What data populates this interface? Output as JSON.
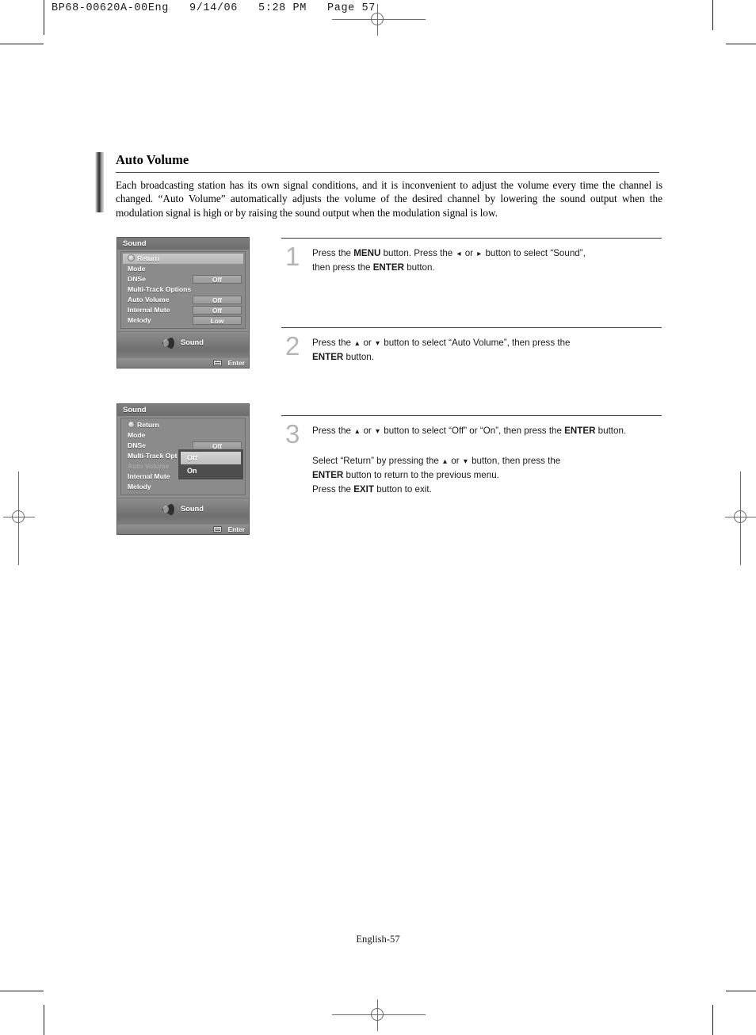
{
  "print_header": "BP68-00620A-00Eng   9/14/06   5:28 PM   Page 57",
  "section": {
    "title": "Auto Volume",
    "body": "Each broadcasting station has its own signal conditions, and it is inconvenient to adjust the volume every time the channel is changed. “Auto Volume” automatically adjusts the volume of the desired channel by lowering the sound output when the modulation signal is high or by raising the sound output when the modulation signal is low."
  },
  "osd_menu_1": {
    "title": "Sound",
    "rows": [
      {
        "label": "Return",
        "value": "",
        "selected": true,
        "icon": "return-icon"
      },
      {
        "label": "Mode",
        "value": ""
      },
      {
        "label": "DNSe",
        "value": "Off"
      },
      {
        "label": "Multi-Track Options",
        "value": ""
      },
      {
        "label": "Auto Volume",
        "value": "Off"
      },
      {
        "label": "Internal Mute",
        "value": "Off"
      },
      {
        "label": "Melody",
        "value": "Low"
      }
    ],
    "footer_label": "Sound",
    "enter_label": "Enter"
  },
  "osd_menu_2": {
    "title": "Sound",
    "rows": [
      {
        "label": "Return",
        "value": "",
        "icon": "return-icon"
      },
      {
        "label": "Mode",
        "value": ""
      },
      {
        "label": "DNSe",
        "value": "Off"
      },
      {
        "label": "Multi-Track Options",
        "value": ""
      },
      {
        "label": "Auto Volume",
        "value": "",
        "dimmed": true
      },
      {
        "label": "Internal Mute",
        "value": ""
      },
      {
        "label": "Melody",
        "value": ""
      }
    ],
    "dropdown": {
      "options": [
        {
          "label": "Off",
          "highlighted": true
        },
        {
          "label": "On",
          "highlighted": false
        }
      ]
    },
    "footer_label": "Sound",
    "enter_label": "Enter"
  },
  "steps": [
    {
      "number": "1",
      "parts": [
        {
          "t": "text",
          "v": "Press the "
        },
        {
          "t": "bold",
          "v": "MENU"
        },
        {
          "t": "text",
          "v": " button. Press the "
        },
        {
          "t": "icon",
          "v": "◂"
        },
        {
          "t": "text",
          "v": " or "
        },
        {
          "t": "icon",
          "v": "▸"
        },
        {
          "t": "text",
          "v": " button to select “Sound”,"
        },
        {
          "t": "br",
          "v": ""
        },
        {
          "t": "text",
          "v": "then press the "
        },
        {
          "t": "bold",
          "v": "ENTER"
        },
        {
          "t": "text",
          "v": " button."
        }
      ]
    },
    {
      "number": "2",
      "parts": [
        {
          "t": "text",
          "v": "Press the "
        },
        {
          "t": "icon",
          "v": "▴"
        },
        {
          "t": "text",
          "v": " or "
        },
        {
          "t": "icon",
          "v": "▾"
        },
        {
          "t": "text",
          "v": " button to select “Auto Volume”, then press the"
        },
        {
          "t": "br",
          "v": ""
        },
        {
          "t": "bold",
          "v": "ENTER"
        },
        {
          "t": "text",
          "v": " button."
        }
      ]
    },
    {
      "number": "3",
      "parts": [
        {
          "t": "text",
          "v": "Press the "
        },
        {
          "t": "icon",
          "v": "▴"
        },
        {
          "t": "text",
          "v": " or "
        },
        {
          "t": "icon",
          "v": "▾"
        },
        {
          "t": "text",
          "v": " button to select “Off” or “On”, then press the "
        },
        {
          "t": "bold",
          "v": "ENTER"
        },
        {
          "t": "text",
          "v": " button."
        }
      ],
      "extra_parts": [
        {
          "t": "text",
          "v": "Select “Return” by pressing the "
        },
        {
          "t": "icon",
          "v": "▴"
        },
        {
          "t": "text",
          "v": " or "
        },
        {
          "t": "icon",
          "v": "▾"
        },
        {
          "t": "text",
          "v": " button, then press the"
        },
        {
          "t": "br",
          "v": ""
        },
        {
          "t": "bold",
          "v": "ENTER"
        },
        {
          "t": "text",
          "v": " button to return to the previous menu."
        },
        {
          "t": "br",
          "v": ""
        },
        {
          "t": "text",
          "v": "Press the "
        },
        {
          "t": "bold",
          "v": "EXIT"
        },
        {
          "t": "text",
          "v": " button to exit."
        }
      ]
    }
  ],
  "footer": "English-57"
}
